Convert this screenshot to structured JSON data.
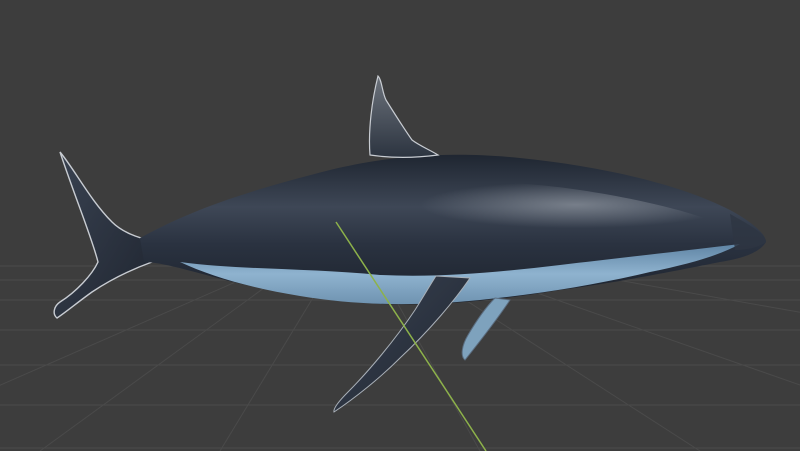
{
  "viewport": {
    "background": "#3d3d3d",
    "grid_color": "#4a4a4a",
    "y_axis_color": "#8db24a",
    "object": "shark-3d-model",
    "shading": "solid"
  },
  "model": {
    "body_top_color": "#2b3442",
    "body_mid_color": "#556070",
    "belly_color": "#8fb3cf",
    "highlight_color": "#7c8592"
  }
}
